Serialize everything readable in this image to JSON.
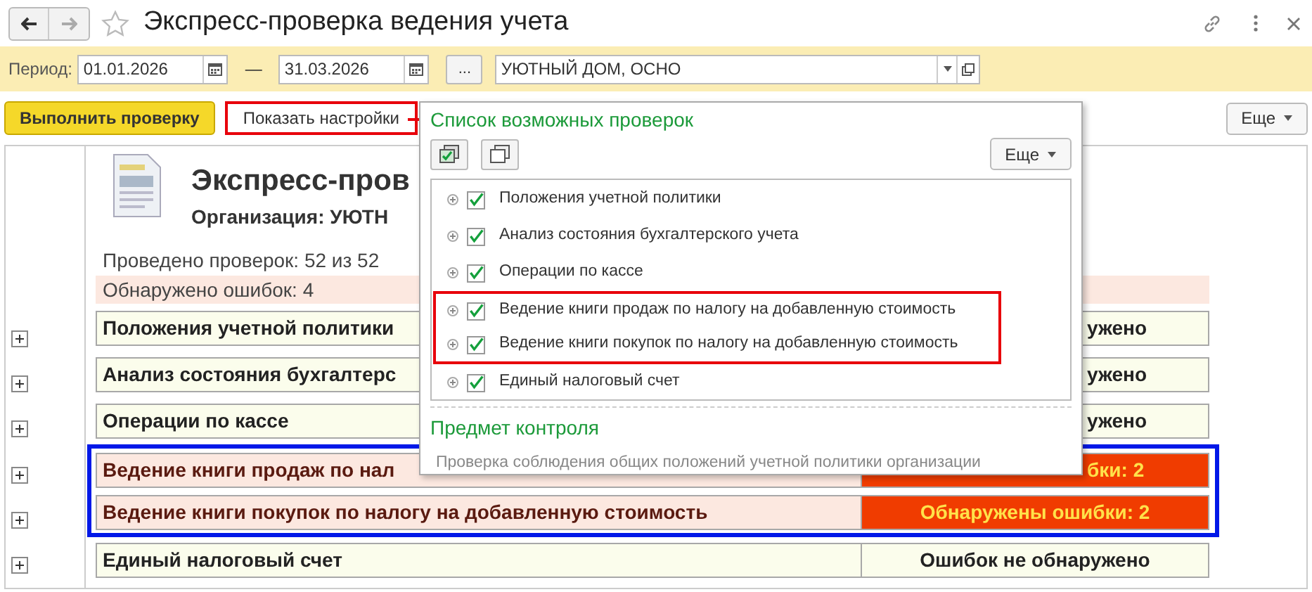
{
  "window": {
    "title": "Экспресс-проверка ведения учета"
  },
  "filter": {
    "period_label": "Период:",
    "date_from": "01.01.2026",
    "separator": "—",
    "date_to": "31.03.2026",
    "ellipsis_button": "...",
    "organization": "УЮТНЫЙ ДОМ, ОСНО"
  },
  "toolbar": {
    "run_button": "Выполнить проверку",
    "settings_button": {
      "label": "Показать настройки",
      "highlighted": true
    },
    "more_button": "Еще"
  },
  "report": {
    "title": "Экспресс-пров",
    "organization": "Организация: УЮТН",
    "checks_done": "Проведено проверок: 52 из 52",
    "errors_found": "Обнаружено ошибок: 4",
    "sections": [
      {
        "name": "Положения учетной политики",
        "result": "ужено",
        "has_errors": false,
        "highlighted": false
      },
      {
        "name": "Анализ состояния бухгалтерс",
        "result": "ужено",
        "has_errors": false,
        "highlighted": false
      },
      {
        "name": "Операции по кассе",
        "result": "ужено",
        "has_errors": false,
        "highlighted": false
      },
      {
        "name": "Ведение книги продаж по нал",
        "result": "бки: 2",
        "has_errors": true,
        "highlighted": true
      },
      {
        "name": "Ведение книги покупок по налогу на добавленную стоимость",
        "result": "Обнаружены ошибки: 2",
        "has_errors": true,
        "highlighted": true
      },
      {
        "name": "Единый налоговый счет",
        "result": "Ошибок не обнаружено",
        "has_errors": false,
        "highlighted": false
      }
    ]
  },
  "checks_panel": {
    "title": "Список возможных проверок",
    "more_button": "Еще",
    "items": [
      {
        "label": "Положения учетной политики",
        "checked": true,
        "highlighted": false
      },
      {
        "label": "Анализ состояния бухгалтерского учета",
        "checked": true,
        "highlighted": false
      },
      {
        "label": "Операции по кассе",
        "checked": true,
        "highlighted": false
      },
      {
        "label": "Ведение книги продаж по налогу на добавленную стоимость",
        "checked": true,
        "highlighted": true
      },
      {
        "label": "Ведение книги покупок по налогу на добавленную стоимость",
        "checked": true,
        "highlighted": true
      },
      {
        "label": "Единый налоговый счет",
        "checked": true,
        "highlighted": false
      }
    ],
    "subject_heading": "Предмет контроля",
    "subject_text": "Проверка соблюдения общих положений учетной политики организации"
  }
}
